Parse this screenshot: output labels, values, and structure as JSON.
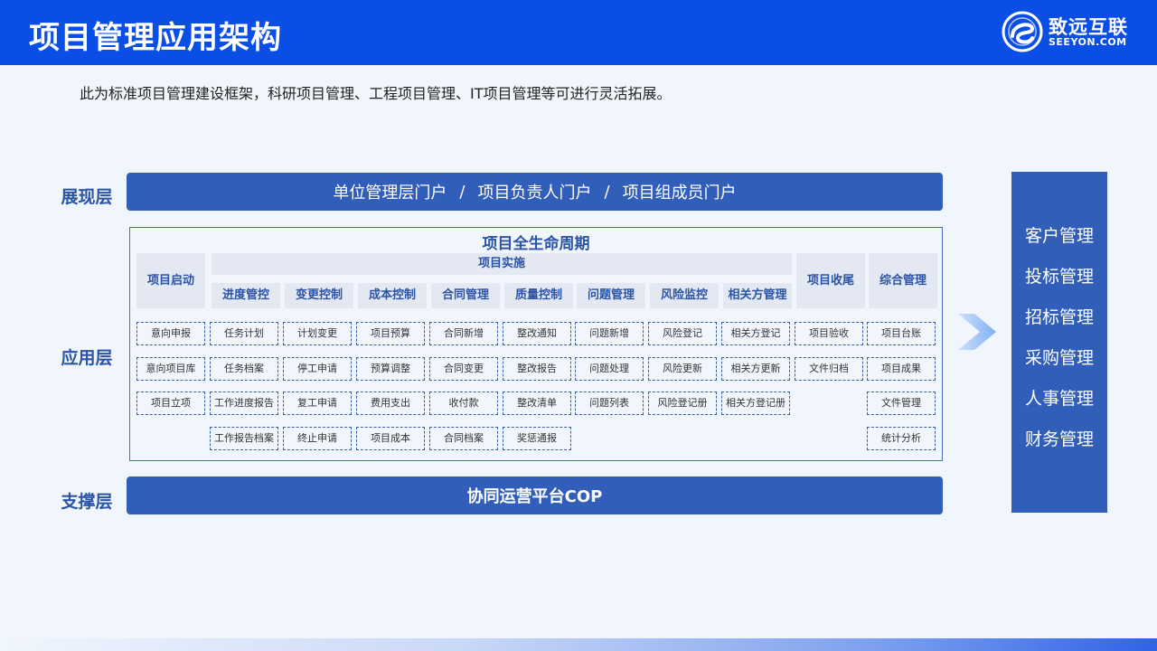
{
  "header": {
    "title": "项目管理应用架构",
    "logo_cn": "致远互联",
    "logo_en": "SEEYON.COM"
  },
  "subtitle": "此为标准项目管理建设框架，科研项目管理、工程项目管理、IT项目管理等可进行灵活拓展。",
  "layers": {
    "presentation": "展现层",
    "application": "应用层",
    "support": "支撑层"
  },
  "portal": {
    "items": [
      "单位管理层门户",
      "项目负责人门户",
      "项目组成员门户"
    ],
    "separator": "/"
  },
  "lifecycle": {
    "title": "项目全生命周期",
    "implementation_group": "项目实施",
    "columns": [
      {
        "header": "项目启动",
        "items": [
          "意向申报",
          "意向项目库",
          "项目立项"
        ]
      },
      {
        "header": "进度管控",
        "items": [
          "任务计划",
          "任务档案",
          "工作进度报告",
          "工作报告档案"
        ]
      },
      {
        "header": "变更控制",
        "items": [
          "计划变更",
          "停工申请",
          "复工申请",
          "终止申请"
        ]
      },
      {
        "header": "成本控制",
        "items": [
          "项目预算",
          "预算调整",
          "费用支出",
          "项目成本"
        ]
      },
      {
        "header": "合同管理",
        "items": [
          "合同新增",
          "合同变更",
          "收付款",
          "合同档案"
        ]
      },
      {
        "header": "质量控制",
        "items": [
          "整改通知",
          "整改报告",
          "整改清单",
          "奖惩通报"
        ]
      },
      {
        "header": "问题管理",
        "items": [
          "问题新增",
          "问题处理",
          "问题列表"
        ]
      },
      {
        "header": "风险监控",
        "items": [
          "风险登记",
          "风险更新",
          "风险登记册"
        ]
      },
      {
        "header": "相关方管理",
        "items": [
          "相关方登记",
          "相关方更新",
          "相关方登记册"
        ]
      },
      {
        "header": "项目收尾",
        "items": [
          "项目验收",
          "文件归档"
        ]
      },
      {
        "header": "综合管理",
        "items": [
          "项目台账",
          "项目成果",
          "文件管理",
          "统计分析"
        ]
      }
    ]
  },
  "support_bar": "协同运营平台COP",
  "side_panel": [
    "客户管理",
    "投标管理",
    "招标管理",
    "采购管理",
    "人事管理",
    "财务管理"
  ],
  "colors": {
    "header_blue": "#0a4ee6",
    "bar_blue": "#315eb8",
    "label_blue": "#2b54a7",
    "background": "#f1f6fd"
  }
}
